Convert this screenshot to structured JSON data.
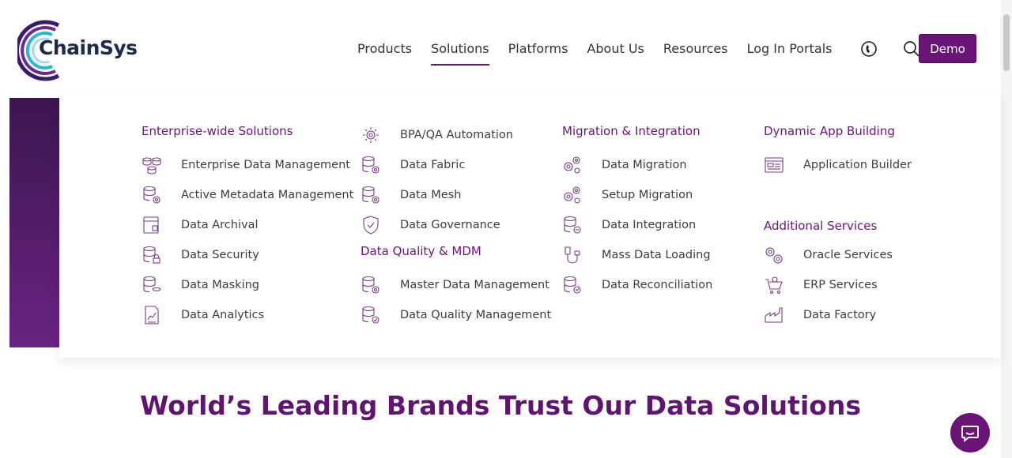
{
  "brand": {
    "name": "ChainSys",
    "accent": "#6b1477"
  },
  "nav": {
    "items": [
      "Products",
      "Solutions",
      "Platforms",
      "About Us",
      "Resources",
      "Log In Portals"
    ],
    "active": "Solutions",
    "icons": [
      "clock-phone-icon",
      "search-icon"
    ],
    "demo_label": "Demo"
  },
  "menu": {
    "enterprise": {
      "title": "Enterprise-wide Solutions",
      "items": [
        "Enterprise Data Management",
        "Active Metadata Management",
        "Data Archival",
        "Data Security",
        "Data Masking",
        "Data Analytics"
      ]
    },
    "automation": {
      "items": [
        "BPA/QA Automation",
        "Data Fabric",
        "Data Mesh",
        "Data Governance"
      ]
    },
    "quality": {
      "title": "Data Quality & MDM",
      "items": [
        "Master Data Management",
        "Data Quality Management"
      ]
    },
    "migration": {
      "title": "Migration & Integration",
      "items": [
        "Data Migration",
        "Setup Migration",
        "Data Integration",
        "Mass Data Loading",
        "Data Reconciliation"
      ]
    },
    "dynamic": {
      "title": "Dynamic App Building",
      "items": [
        "Application Builder"
      ]
    },
    "additional": {
      "title": "Additional Services",
      "items": [
        "Oracle Services",
        "ERP Services",
        "Data Factory"
      ]
    }
  },
  "page": {
    "heading": "World’s Leading Brands Trust Our Data Solutions"
  }
}
